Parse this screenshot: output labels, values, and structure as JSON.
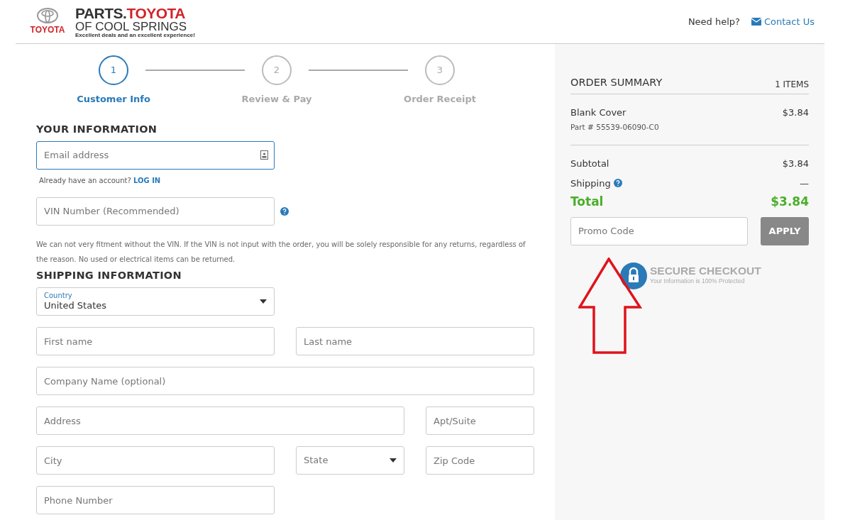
{
  "header": {
    "brand_logo": {
      "top": "PARTS.",
      "top_red": "TOYOTA",
      "middle": "OF COOL SPRINGS",
      "tagline": "Excellent deals and an excellent experience!"
    },
    "maker_logo": "TOYOTA",
    "help_text": "Need help?",
    "contact_link": "Contact Us"
  },
  "steps": [
    {
      "number": "1",
      "label": "Customer Info",
      "selected": true
    },
    {
      "number": "2",
      "label": "Review & Pay",
      "selected": false
    },
    {
      "number": "3",
      "label": "Order Receipt",
      "selected": false
    }
  ],
  "your_information": {
    "title": "YOUR INFORMATION",
    "email": {
      "placeholder": "Email address"
    },
    "account_text": "Already have an account?",
    "login_link": "LOG IN",
    "vin": {
      "placeholder": "VIN Number (Recommended)"
    },
    "note": "We can not very fitment without the VIN. If the VIN is not input with the order, you will be solely responsible for any returns, regardless of the reason. No used or electrical items can be returned."
  },
  "shipping_information": {
    "title": "SHIPPING INFORMATION",
    "fields": [
      {
        "kind": "select",
        "label": "Country",
        "value": "United States"
      },
      {
        "kind": "input",
        "placeholder": "First name"
      },
      {
        "kind": "input",
        "placeholder": "Last name"
      },
      {
        "kind": "input",
        "placeholder": "Company Name (optional)"
      },
      {
        "kind": "input",
        "placeholder": "Address"
      },
      {
        "kind": "input",
        "placeholder": "Apt/Suite"
      },
      {
        "kind": "input",
        "placeholder": "City"
      },
      {
        "kind": "select",
        "placeholder": "State"
      },
      {
        "kind": "input",
        "placeholder": "Zip Code"
      },
      {
        "kind": "input",
        "placeholder": "Phone Number"
      }
    ]
  },
  "order_summary": {
    "title": "ORDER SUMMARY",
    "count": "1 ITEMS",
    "items": [
      {
        "name": "Blank Cover",
        "part": "Part # 55539-06090-C0",
        "price": "$3.84"
      }
    ],
    "subtotal_label": "Subtotal",
    "subtotal": "$3.84",
    "shipping_label": "Shipping",
    "shipping": "—",
    "total_label": "Total",
    "total": "$3.84",
    "promo": {
      "placeholder": "Promo Code"
    },
    "apply_button": "APPLY",
    "secure_title": "SECURE CHECKOUT",
    "secure_subtitle": "Your Information is 100% Protected"
  }
}
